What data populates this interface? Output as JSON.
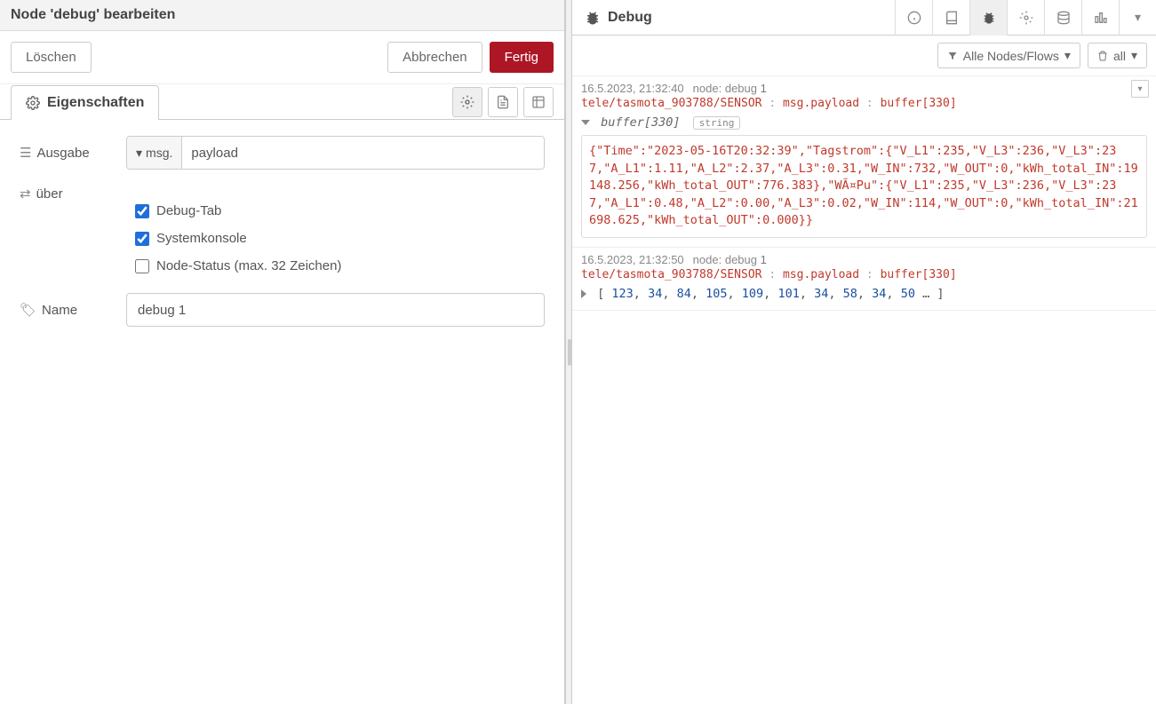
{
  "edit": {
    "title": "Node 'debug' bearbeiten",
    "delete": "Löschen",
    "cancel": "Abbrechen",
    "done": "Fertig",
    "tab_properties": "Eigenschaften",
    "labels": {
      "output": "Ausgabe",
      "to": "über",
      "name": "Name"
    },
    "msg_prefix": "msg.",
    "output_value": "payload",
    "cb_debug_tab": "Debug-Tab",
    "cb_console": "Systemkonsole",
    "cb_status": "Node-Status (max. 32 Zeichen)",
    "name_value": "debug 1"
  },
  "debug": {
    "title": "Debug",
    "filter_label": "Alle Nodes/Flows",
    "clear_label": "all",
    "messages": [
      {
        "time": "16.5.2023, 21:32:40",
        "node_label": "node:",
        "node_name": "debug",
        "node_num": "1",
        "topic": "tele/tasmota_903788/SENSOR",
        "prop": "msg.payload",
        "type": "buffer[330]",
        "buffer_label": "buffer[330]",
        "badge": "string",
        "content": "{\"Time\":\"2023-05-16T20:32:39\",\"Tagstrom\":{\"V_L1\":235,\"V_L3\":236,\"V_L3\":237,\"A_L1\":1.11,\"A_L2\":2.37,\"A_L3\":0.31,\"W_IN\":732,\"W_OUT\":0,\"kWh_total_IN\":19148.256,\"kWh_total_OUT\":776.383},\"WÃ¤Pu\":{\"V_L1\":235,\"V_L3\":236,\"V_L3\":237,\"A_L1\":0.48,\"A_L2\":0.00,\"A_L3\":0.02,\"W_IN\":114,\"W_OUT\":0,\"kWh_total_IN\":21698.625,\"kWh_total_OUT\":0.000}}"
      },
      {
        "time": "16.5.2023, 21:32:50",
        "node_label": "node:",
        "node_name": "debug",
        "node_num": "1",
        "topic": "tele/tasmota_903788/SENSOR",
        "prop": "msg.payload",
        "type": "buffer[330]",
        "array_preview": [
          "123",
          "34",
          "84",
          "105",
          "109",
          "101",
          "34",
          "58",
          "34",
          "50"
        ]
      }
    ]
  }
}
